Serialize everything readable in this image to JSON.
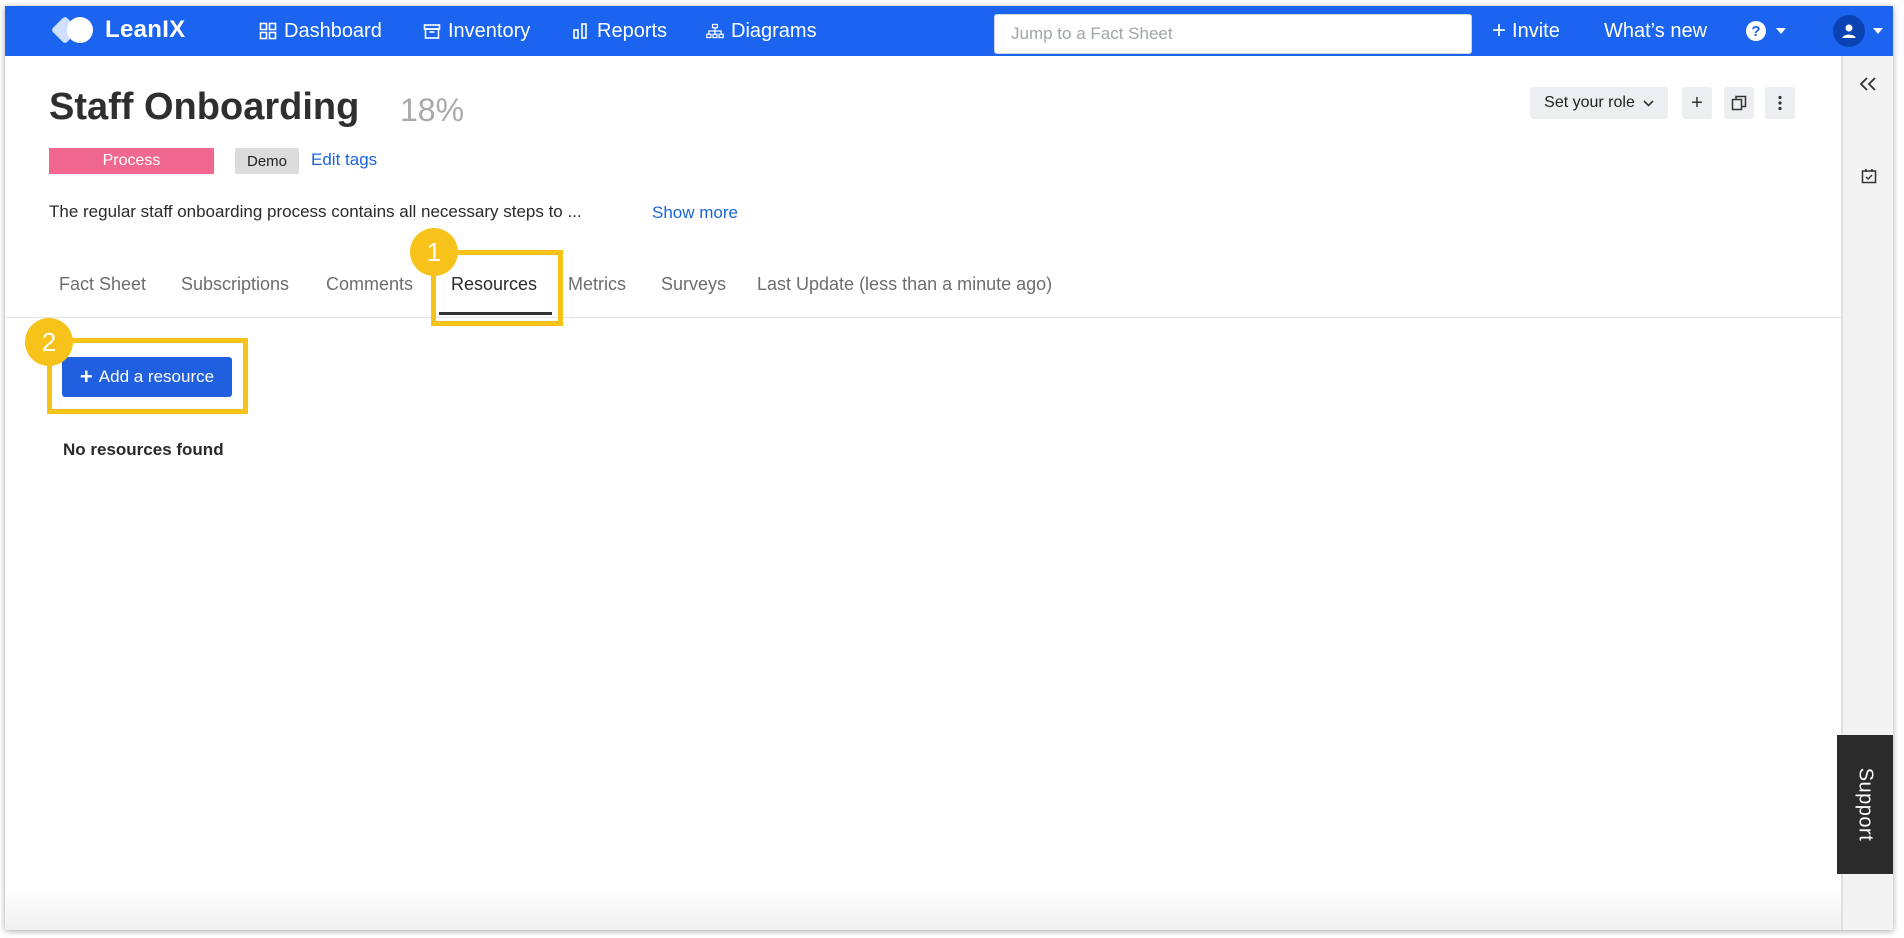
{
  "topbar": {
    "brand": "LeanIX",
    "nav": [
      {
        "label": "Dashboard",
        "icon": "grid-icon"
      },
      {
        "label": "Inventory",
        "icon": "inventory-icon"
      },
      {
        "label": "Reports",
        "icon": "bar-chart-icon"
      },
      {
        "label": "Diagrams",
        "icon": "sitemap-icon"
      }
    ],
    "search_placeholder": "Jump to a Fact Sheet",
    "invite_label": "Invite",
    "whats_new_label": "What’s new",
    "help_glyph": "?",
    "colors": {
      "bar": "#1a64f0"
    }
  },
  "factsheet": {
    "title": "Staff Onboarding",
    "completion": "18%",
    "type_badge": "Process",
    "tags": [
      "Demo"
    ],
    "edit_tags_label": "Edit tags",
    "description": "The regular staff onboarding process contains all necessary steps to ...",
    "show_more_label": "Show more",
    "role_select": "Set your role",
    "colors": {
      "type_badge": "#f06790",
      "link": "#1a64d8"
    }
  },
  "tabs": [
    {
      "label": "Fact Sheet",
      "active": false
    },
    {
      "label": "Subscriptions",
      "active": false
    },
    {
      "label": "Comments",
      "active": false
    },
    {
      "label": "Resources",
      "active": true
    },
    {
      "label": "Metrics",
      "active": false
    },
    {
      "label": "Surveys",
      "active": false
    },
    {
      "label": "Last Update (less than a minute ago)",
      "active": false
    }
  ],
  "resources": {
    "add_button_label": "Add a resource",
    "empty_message": "No resources found"
  },
  "annotations": {
    "step_1": "1",
    "step_2": "2",
    "color": "#f7c21a"
  },
  "rail": {
    "support_label": "Support"
  }
}
